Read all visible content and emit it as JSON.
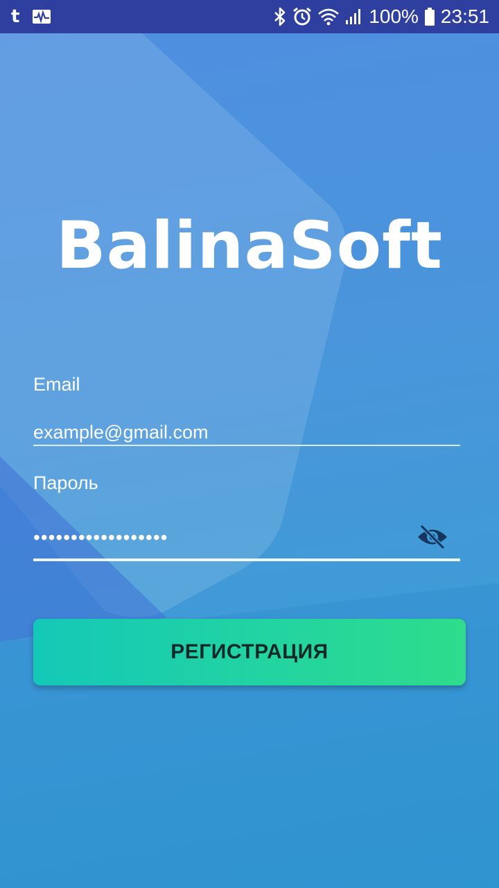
{
  "status_bar": {
    "left_icons": [
      "tumblr-icon",
      "activity-icon"
    ],
    "right_icons": [
      "bluetooth-icon",
      "alarm-icon",
      "wifi-icon",
      "signal-icon",
      "battery-icon"
    ],
    "tumblr_glyph": "t",
    "battery_percent": "100%",
    "time": "23:51",
    "background_color": "#2f3fa0"
  },
  "logo": {
    "text": "BalinaSoft"
  },
  "form": {
    "email_label": "Email",
    "email_value": "example@gmail.com",
    "password_label": "Пароль",
    "password_value": "••••••••••••••••••",
    "password_toggle_icon": "eye-off-icon"
  },
  "register_button": {
    "label": "РЕГИСТРАЦИЯ",
    "gradient_start": "#14c8b8",
    "gradient_end": "#2edc8c",
    "text_color": "#102a2a"
  },
  "colors": {
    "background_top": "#4f8fe0",
    "background_bottom": "#2f9bd0",
    "text": "#ffffff"
  }
}
